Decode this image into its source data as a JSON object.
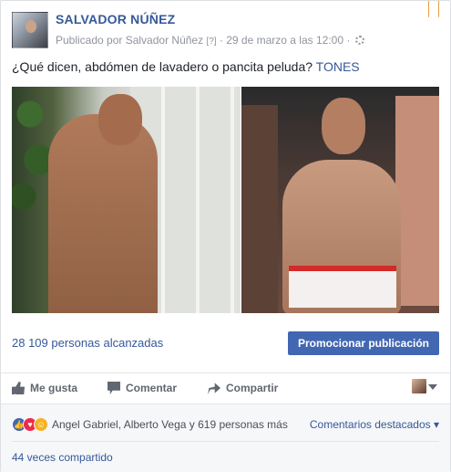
{
  "post": {
    "author": "SALVADOR NÚÑEZ",
    "meta_prefix": "Publicado por Salvador Núñez",
    "meta_help": "[?]",
    "meta_date": "· 29 de marzo a las 12:00 ·",
    "text": "¿Qué dicen, abdómen de lavadero o pancita peluda?",
    "text_tag": "TONES"
  },
  "stats": {
    "reach": "28 109 personas alcanzadas",
    "promote_button": "Promocionar publicación"
  },
  "actions": {
    "like": "Me gusta",
    "comment": "Comentar",
    "share": "Compartir"
  },
  "reactions": {
    "names": "Angel Gabriel, Alberto Vega y 619 personas más",
    "top_comments": "Comentarios destacados",
    "shares": "44 veces compartido"
  },
  "colors": {
    "link": "#365899",
    "primary_button": "#4267b2",
    "like": "#4267b2",
    "love": "#f0284a",
    "haha": "#f7b125"
  },
  "icons": [
    "bookmark-icon",
    "gear-icon",
    "like-icon",
    "comment-icon",
    "share-icon",
    "chevron-down-icon"
  ]
}
